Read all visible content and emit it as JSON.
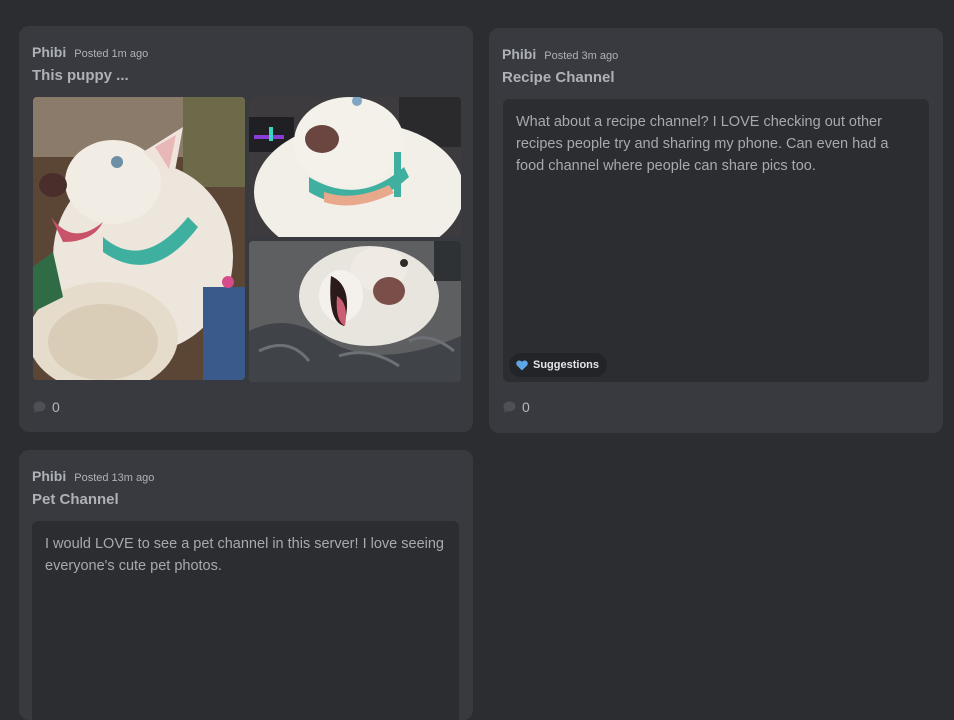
{
  "posts": [
    {
      "author": "Phibi",
      "posted": "Posted 1m ago",
      "title": "This puppy ...",
      "replies": "0",
      "images": [
        "husky-puppy-photo",
        "husky-puppy-photo",
        "husky-puppy-photo"
      ]
    },
    {
      "author": "Phibi",
      "posted": "Posted 3m ago",
      "title": "Recipe Channel",
      "body": "What about a recipe channel? I LOVE checking out other recipes people try and sharing my phone. Can even had a food channel where people can share pics too.",
      "tag": {
        "emoji_color": "#5da5e6",
        "label": "Suggestions"
      },
      "replies": "0"
    },
    {
      "author": "Phibi",
      "posted": "Posted 13m ago",
      "title": "Pet Channel",
      "body": "I would LOVE to see a pet channel in this server! I love seeing everyone's cute pet photos."
    }
  ],
  "icons": {
    "reply": "speech-bubble-icon",
    "tag": "blue-heart-icon"
  },
  "colors": {
    "background": "#2b2d31",
    "card": "#383a40",
    "preview": "#2b2d31",
    "tag_heart": "#5da5e6"
  }
}
